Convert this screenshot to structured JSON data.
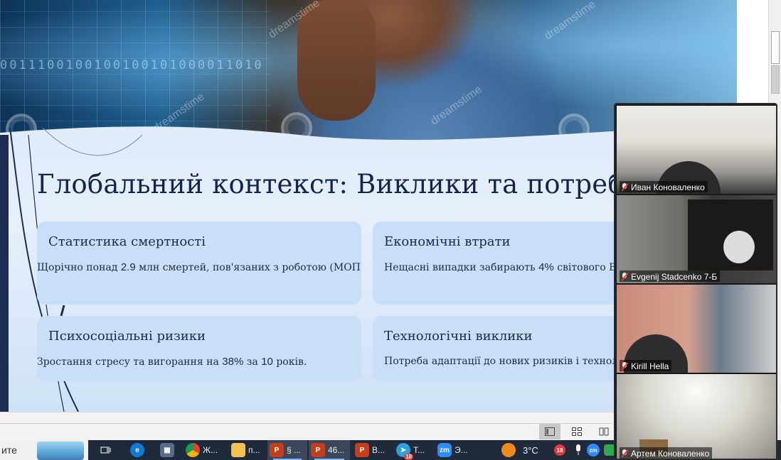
{
  "slide": {
    "title": "Глобальний контекст: Виклики та потреби",
    "watermark_text": "dreamstime",
    "binary_text": "0011100100100100101000011010",
    "cards": [
      {
        "heading": "Статистика смертності",
        "text_pre": "Щорічно понад ",
        "text_num": "2.9",
        "text_post": " млн смертей, пов'язаних з роботою (МОП)."
      },
      {
        "heading": "Економічні втрати",
        "text_pre": "Нещасні випадки забирають ",
        "text_num": "4%",
        "text_post": " світового ВВ"
      },
      {
        "heading": "Психосоціальні ризики",
        "text_pre": "Зростання стресу та вигорання на ",
        "text_num": "38%",
        "text_mid": " за ",
        "text_num2": "10",
        "text_post": " років."
      },
      {
        "heading": "Технологічні виклики",
        "text_pre": "Потреба адаптації до нових ризиків і техноло",
        "text_num": "",
        "text_post": ""
      }
    ]
  },
  "participants": [
    {
      "name": "Иван Коноваленко",
      "muted": true
    },
    {
      "name": "Evgenij Stadcenko 7-Б",
      "muted": true
    },
    {
      "name": "Kirill Hella",
      "muted": true
    },
    {
      "name": "Артем Коноваленко",
      "muted": true
    }
  ],
  "statusbar": {
    "views": [
      "normal-view-icon",
      "slide-sorter-icon",
      "reading-view-icon"
    ]
  },
  "taskbar": {
    "search_text": "ите",
    "items": [
      {
        "icon": "task-view-icon",
        "label": ""
      },
      {
        "icon": "edge-icon",
        "label": ""
      },
      {
        "icon": "calculator-icon",
        "label": ""
      },
      {
        "icon": "chrome-icon",
        "label": "Ж..."
      },
      {
        "icon": "folder-icon",
        "label": "п..."
      },
      {
        "icon": "powerpoint-icon",
        "label": "§ ..."
      },
      {
        "icon": "powerpoint-icon",
        "label": "46..."
      },
      {
        "icon": "powerpoint-icon",
        "label": "В..."
      },
      {
        "icon": "telegram-icon",
        "label": "Т...",
        "badge": "18"
      },
      {
        "icon": "zoom-icon",
        "label": "Э..."
      }
    ],
    "weather": "3°C",
    "tray_badge": "18",
    "colors": {
      "powerpoint": "#c43e1c",
      "zoom": "#2d8cff",
      "telegram": "#2aa1da",
      "edge": "#0f7bd6"
    }
  }
}
